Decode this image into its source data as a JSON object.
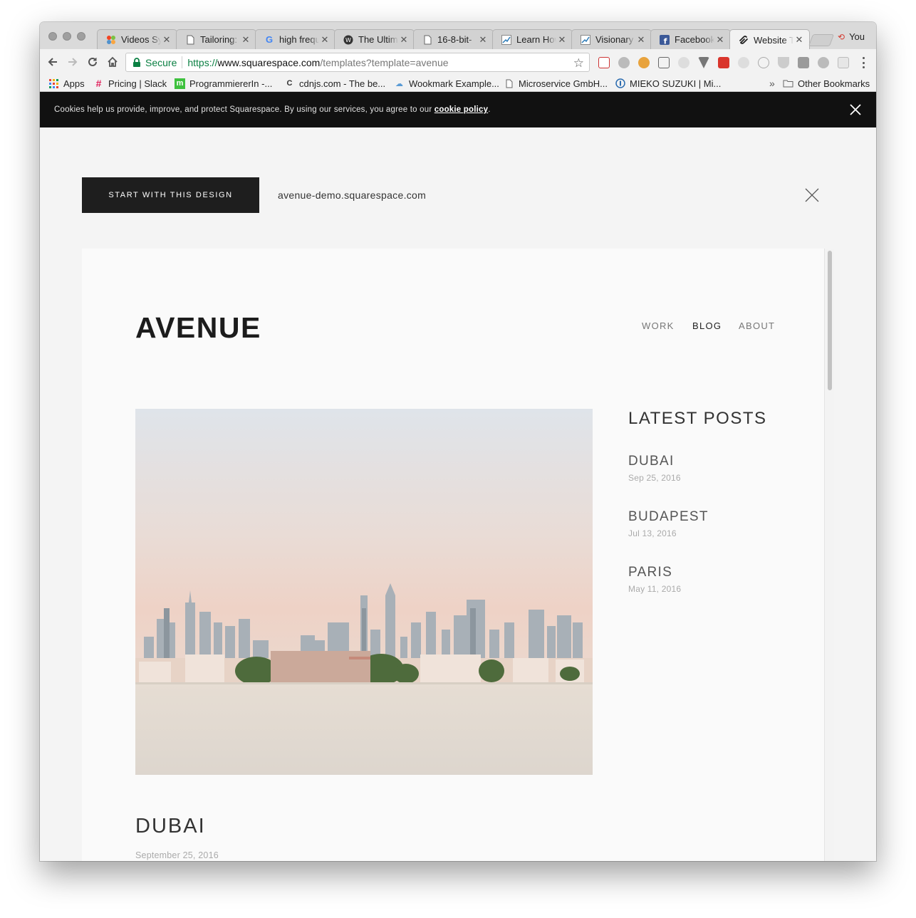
{
  "browser": {
    "tabs": [
      {
        "title": "Videos Sy",
        "icon": "joomla-icon"
      },
      {
        "title": "Tailoring: ",
        "icon": "page-icon"
      },
      {
        "title": "high frequ",
        "icon": "google-icon"
      },
      {
        "title": "The Ultim",
        "icon": "wordpress-icon"
      },
      {
        "title": "16-8-bit-",
        "icon": "page-icon"
      },
      {
        "title": "Learn How",
        "icon": "chart-icon"
      },
      {
        "title": "Visionary ",
        "icon": "chart-icon"
      },
      {
        "title": "Facebook ",
        "icon": "facebook-icon"
      },
      {
        "title": "Website T",
        "icon": "squarespace-icon"
      }
    ],
    "profile_label": "You",
    "address": {
      "secure_label": "Secure",
      "scheme": "https://",
      "host": "www.squarespace.com",
      "path": "/templates?template=avenue"
    },
    "bookmarks": [
      {
        "label": "Apps"
      },
      {
        "label": "Pricing | Slack"
      },
      {
        "label": "ProgrammiererIn -..."
      },
      {
        "label": "cdnjs.com - The be..."
      },
      {
        "label": "Wookmark Example..."
      },
      {
        "label": "Microservice GmbH..."
      },
      {
        "label": "MIEKO SUZUKI | Mi..."
      }
    ],
    "bookmarks_overflow": "»",
    "other_bookmarks": "Other Bookmarks"
  },
  "cookie_bar": {
    "text": "Cookies help us provide, improve, and protect Squarespace. By using our services, you agree to our ",
    "link": "cookie policy",
    "period": "."
  },
  "preview_bar": {
    "start_button": "START WITH THIS DESIGN",
    "demo_url": "avenue-demo.squarespace.com"
  },
  "site": {
    "logo": "AVENUE",
    "nav": [
      {
        "label": "WORK",
        "active": false
      },
      {
        "label": "BLOG",
        "active": true
      },
      {
        "label": "ABOUT",
        "active": false
      }
    ],
    "latest_posts": {
      "title": "LATEST POSTS",
      "posts": [
        {
          "title": "DUBAI",
          "date": "Sep 25, 2016"
        },
        {
          "title": "BUDAPEST",
          "date": "Jul 13, 2016"
        },
        {
          "title": "PARIS",
          "date": "May 11, 2016"
        }
      ]
    },
    "article": {
      "title": "DUBAI",
      "date": "September 25, 2016"
    }
  },
  "colors": {
    "secure_green": "#0b8043",
    "cookie_bar": "#111111",
    "start_button": "#1e1e1e"
  }
}
